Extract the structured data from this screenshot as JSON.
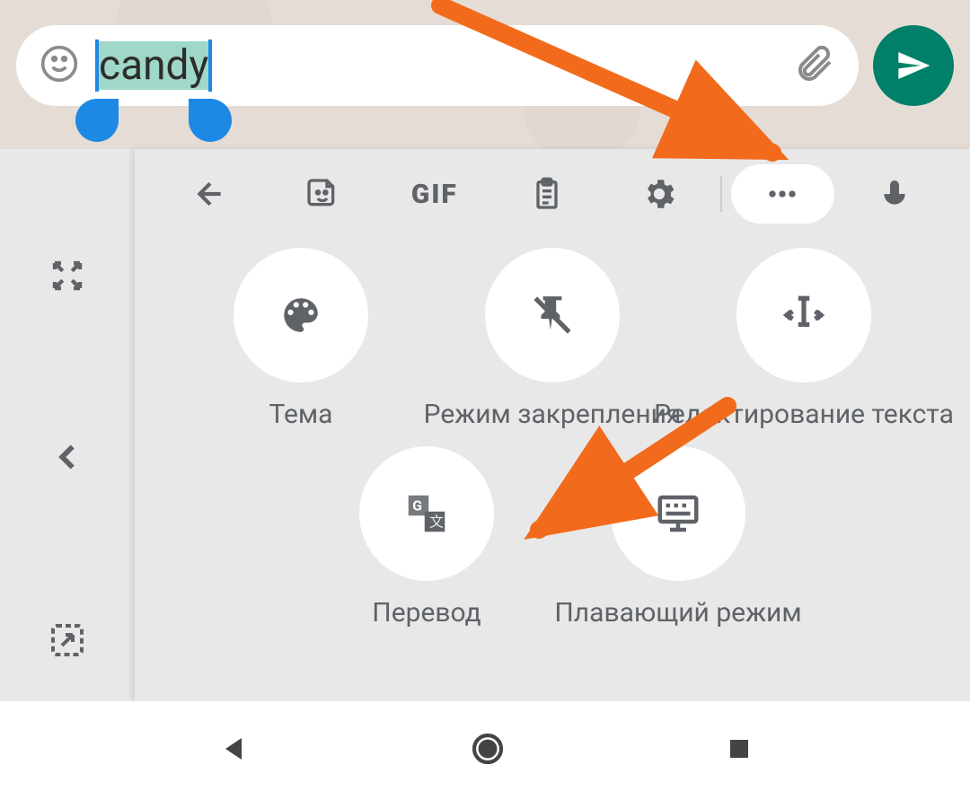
{
  "input_text": "candy",
  "options": {
    "row1": [
      {
        "label": "Тема",
        "icon": "palette"
      },
      {
        "label": "Режим закрепления",
        "icon": "pin"
      },
      {
        "label": "Редактирование текста",
        "icon": "textedit"
      }
    ],
    "row2": [
      {
        "label": "Перевод",
        "icon": "translate"
      },
      {
        "label": "Плавающий режим",
        "icon": "floating"
      }
    ]
  },
  "toolbar": {
    "gif": "GIF"
  }
}
